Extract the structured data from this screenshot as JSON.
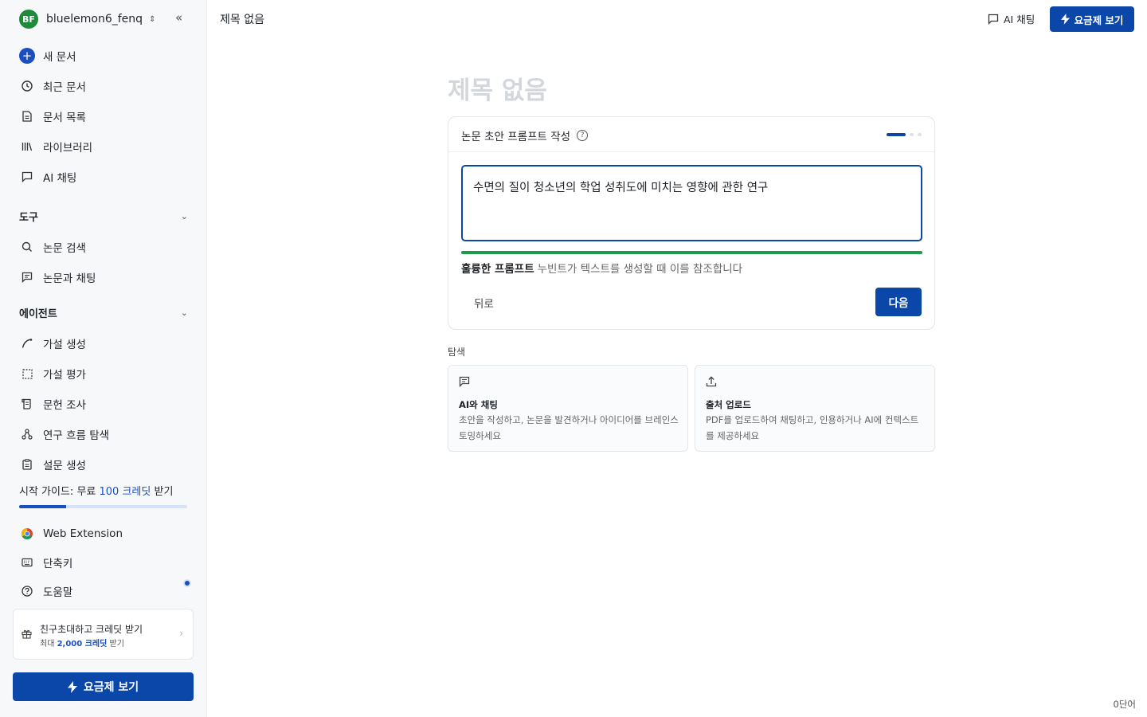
{
  "account": {
    "initials": "BF",
    "name": "bluelemon6_fenq"
  },
  "nav": [
    {
      "label": "새 문서",
      "icon": "plus-icon"
    },
    {
      "label": "최근 문서",
      "icon": "clock-icon"
    },
    {
      "label": "문서 목록",
      "icon": "document-icon"
    },
    {
      "label": "라이브러리",
      "icon": "library-icon"
    },
    {
      "label": "AI 채팅",
      "icon": "chat-icon"
    }
  ],
  "tools": {
    "title": "도구",
    "items": [
      {
        "label": "논문 검색",
        "icon": "search-icon"
      },
      {
        "label": "논문과 채팅",
        "icon": "chat-lines-icon"
      }
    ]
  },
  "agents": {
    "title": "에이전트",
    "items": [
      {
        "label": "가설 생성",
        "icon": "curve-icon"
      },
      {
        "label": "가설 평가",
        "icon": "dashed-square-icon"
      },
      {
        "label": "문헌 조사",
        "icon": "scroll-icon"
      },
      {
        "label": "연구 흐름 탐색",
        "icon": "network-icon"
      },
      {
        "label": "설문 생성",
        "icon": "clipboard-icon"
      }
    ]
  },
  "guide": {
    "prefix": "시작 가이드: 무료",
    "credit": "100 크레딧",
    "suffix": "받기",
    "progress": 0.28
  },
  "bottom_nav": [
    {
      "label": "Web Extension",
      "icon": "chrome-icon"
    },
    {
      "label": "단축키",
      "icon": "keyboard-icon"
    },
    {
      "label": "도움말",
      "icon": "help-icon"
    }
  ],
  "invite": {
    "title": "친구초대하고 크레딧 받기",
    "sub_prefix": "최대",
    "sub_amount": "2,000 크레딧",
    "sub_suffix": "받기"
  },
  "sidebar_plan_button": "요금제 보기",
  "header": {
    "doc_title": "제목 없음",
    "ai_chat": "AI 채팅",
    "plan_button": "요금제 보기"
  },
  "main": {
    "big_title": "제목 없음",
    "card": {
      "title": "논문 초안 프롬프트 작성",
      "help_glyph": "?",
      "step_current": 1,
      "step_total": 3,
      "prompt": "수면의 질이 청소년의 학업 성취도에 미치는 영향에 관한 연구",
      "quality": 1.0,
      "quality_label": "훌륭한 프롬프트",
      "quality_desc": "누빈트가 텍스트를 생성할 때 이를 참조합니다",
      "back": "뒤로",
      "next": "다음"
    },
    "explore": {
      "label": "탐색",
      "cards": [
        {
          "icon": "chat-lines-icon",
          "title": "AI와 채팅",
          "desc": "초안을 작성하고, 논문을 발견하거나 아이디어를 브레인스토밍하세요"
        },
        {
          "icon": "upload-icon",
          "title": "출처 업로드",
          "desc": "PDF를 업로드하여 채팅하고, 인용하거나 AI에 컨텍스트를 제공하세요"
        }
      ]
    }
  },
  "word_count": "0단어",
  "colors": {
    "accent": "#0a47a9",
    "quality": "#1f9a4a",
    "avatar": "#1e8a3a"
  }
}
